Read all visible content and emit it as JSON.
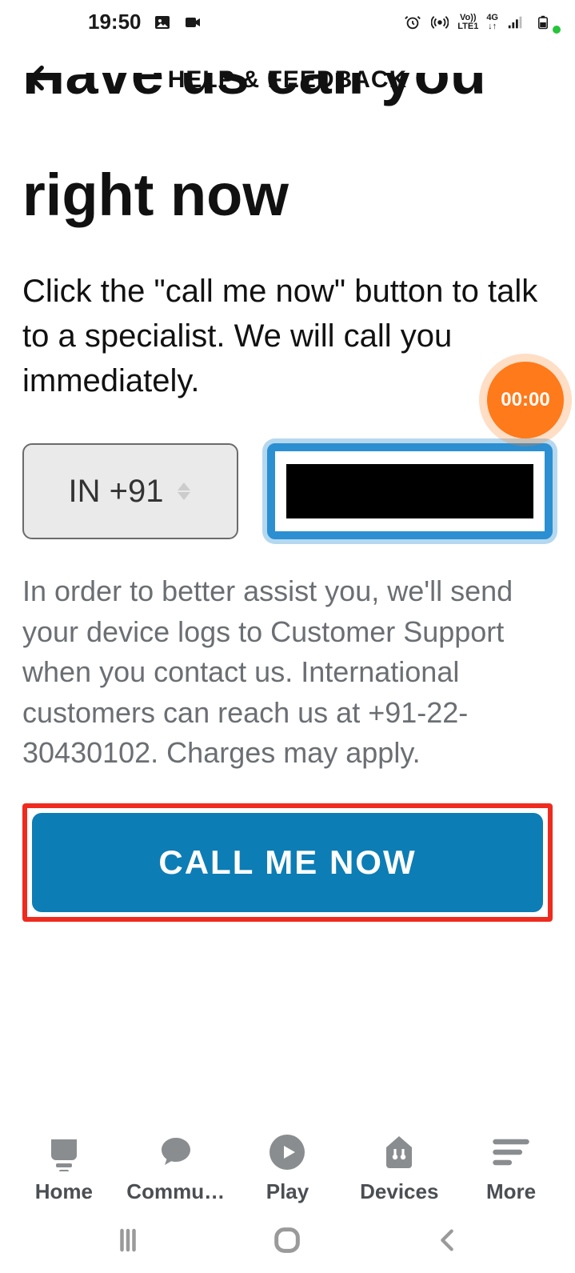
{
  "status": {
    "time": "19:50",
    "net_label1": "Vo))",
    "net_label2": "LTE1",
    "net_label3": "4G"
  },
  "header": {
    "title": "HELP & FEEDBACK"
  },
  "hero": {
    "line1": "Have us call you",
    "line2": "right now"
  },
  "subhead": "Click the \"call me now\" button to talk to a specialist. We will call you immediately.",
  "phone": {
    "country_label": "IN +91",
    "value": ""
  },
  "info": "In order to better assist you, we'll send your device logs to Customer Support when you contact us. International customers can reach us at +91-22-30430102. Charges may apply.",
  "cta": {
    "call_me_now": "CALL ME NOW"
  },
  "tabs": {
    "home": "Home",
    "community": "Commu…",
    "play": "Play",
    "devices": "Devices",
    "more": "More"
  },
  "timer": "00:00",
  "colors": {
    "accent": "#0d7db5",
    "highlight_border": "#ef2b1f",
    "timer": "#ff7a1a"
  }
}
